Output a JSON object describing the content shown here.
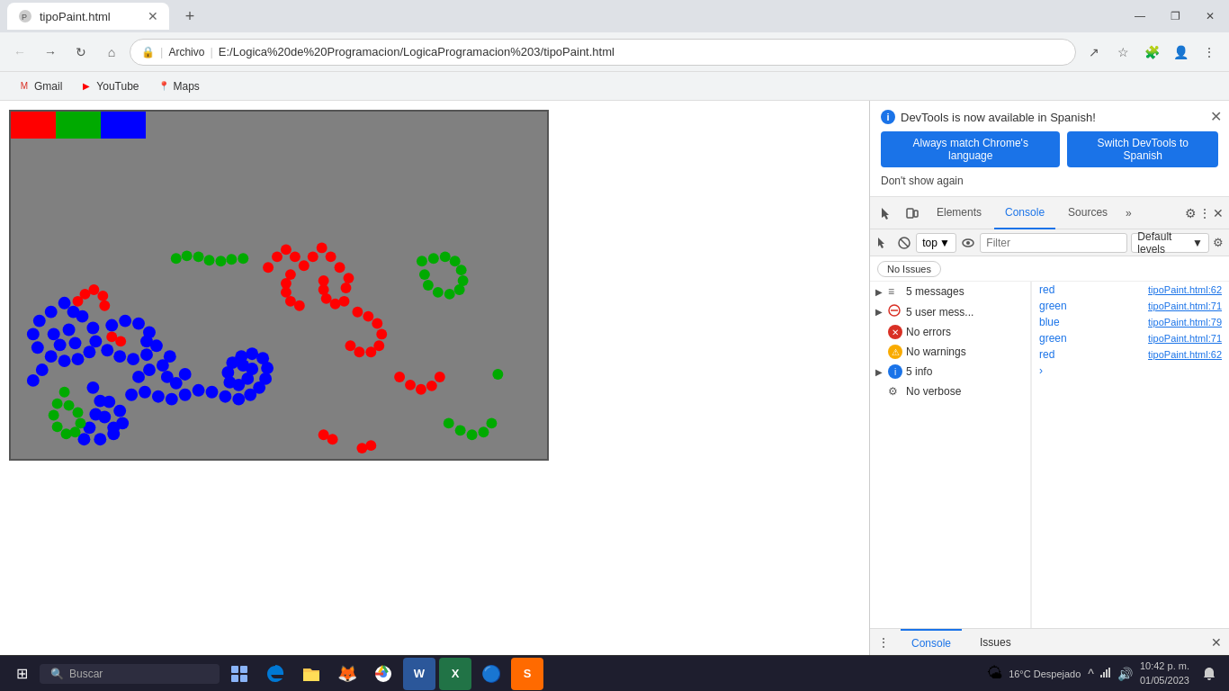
{
  "title_bar": {
    "tab_title": "tipoPaint.html",
    "new_tab_label": "+",
    "controls": {
      "minimize": "—",
      "maximize": "❐",
      "close": "✕"
    }
  },
  "nav_bar": {
    "back": "←",
    "forward": "→",
    "reload": "↻",
    "home": "⌂",
    "lock": "🔒",
    "address_prefix": "Archivo",
    "address_separator": "|",
    "address_url": "E:/Logica%20de%20Programacion/LogicaProgramacion%203/tipoPaint.html",
    "share": "↗",
    "star": "☆",
    "extensions": "🧩",
    "profile": "👤",
    "menu": "⋮"
  },
  "bookmarks_bar": {
    "items": [
      {
        "label": "Gmail",
        "icon": "G"
      },
      {
        "label": "YouTube",
        "icon": "▶"
      },
      {
        "label": "Maps",
        "icon": "📍"
      }
    ]
  },
  "devtools": {
    "banner": {
      "icon": "i",
      "message": "DevTools is now available in Spanish!",
      "btn1": "Always match Chrome's language",
      "btn2": "Switch DevTools to Spanish",
      "dont_show": "Don't show again"
    },
    "toolbar": {
      "tabs": [
        "Elements",
        "Console",
        "Sources"
      ],
      "active_tab": "Console",
      "more": "»",
      "gear": "⚙",
      "kebab": "⋮",
      "close": "✕"
    },
    "console_toolbar": {
      "clear": "🚫",
      "filter_placeholder": "Filter",
      "top_label": "top",
      "eye": "👁",
      "default_levels": "Default levels",
      "settings": "⚙"
    },
    "no_issues": "No Issues",
    "messages": [
      {
        "expanded": false,
        "icon": "list",
        "text": "5 messages"
      },
      {
        "expanded": false,
        "icon": "user",
        "text": "5 user mess..."
      },
      {
        "icon": "error",
        "text": "No errors"
      },
      {
        "icon": "warn",
        "text": "No warnings"
      },
      {
        "expanded": false,
        "icon": "info",
        "text": "5 info"
      },
      {
        "icon": "verbose",
        "text": "No verbose"
      }
    ],
    "log_entries": [
      {
        "color": "red",
        "link": "tipoPaint.html:62"
      },
      {
        "color": "green",
        "link": "tipoPaint.html:71"
      },
      {
        "color": "blue",
        "link": "tipoPaint.html:79"
      },
      {
        "color": "green",
        "link": "tipoPaint.html:71"
      },
      {
        "color": "red",
        "link": "tipoPaint.html:62"
      }
    ],
    "log_arrow": "›",
    "bottom_tabs": [
      "Console",
      "Issues"
    ]
  },
  "taskbar": {
    "start_icon": "⊞",
    "search_placeholder": "Buscar",
    "search_icon": "🔍",
    "icons": [
      "🌤",
      "📋",
      "🌐",
      "📁",
      "📧",
      "🦊",
      "🌐",
      "W",
      "X",
      "🔵",
      "S"
    ],
    "sys_info": {
      "temp": "16°C Despejado",
      "time": "10:42 p. m.",
      "date": "01/05/2023"
    }
  }
}
